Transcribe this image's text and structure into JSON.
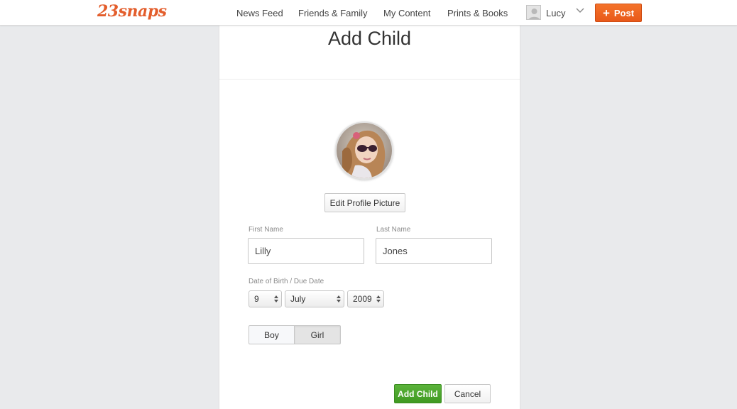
{
  "app": {
    "logo": "23snaps",
    "brand_color": "#e35d2b"
  },
  "nav": {
    "items": [
      "News Feed",
      "Friends & Family",
      "My Content",
      "Prints & Books"
    ],
    "user_name": "Lucy",
    "post_label": "Post",
    "post_color": "#f0682a"
  },
  "page": {
    "title": "Add Child",
    "edit_picture_label": "Edit Profile Picture"
  },
  "form": {
    "first_name_label": "First Name",
    "first_name_value": "Lilly",
    "last_name_label": "Last Name",
    "last_name_value": "Jones",
    "dob_label": "Date of Birth / Due Date",
    "dob_day": "9",
    "dob_month": "July",
    "dob_year": "2009",
    "gender_options": [
      "Boy",
      "Girl"
    ],
    "gender_selected": "Girl"
  },
  "actions": {
    "add_label": "Add Child",
    "cancel_label": "Cancel",
    "add_color": "#4aa52c"
  }
}
